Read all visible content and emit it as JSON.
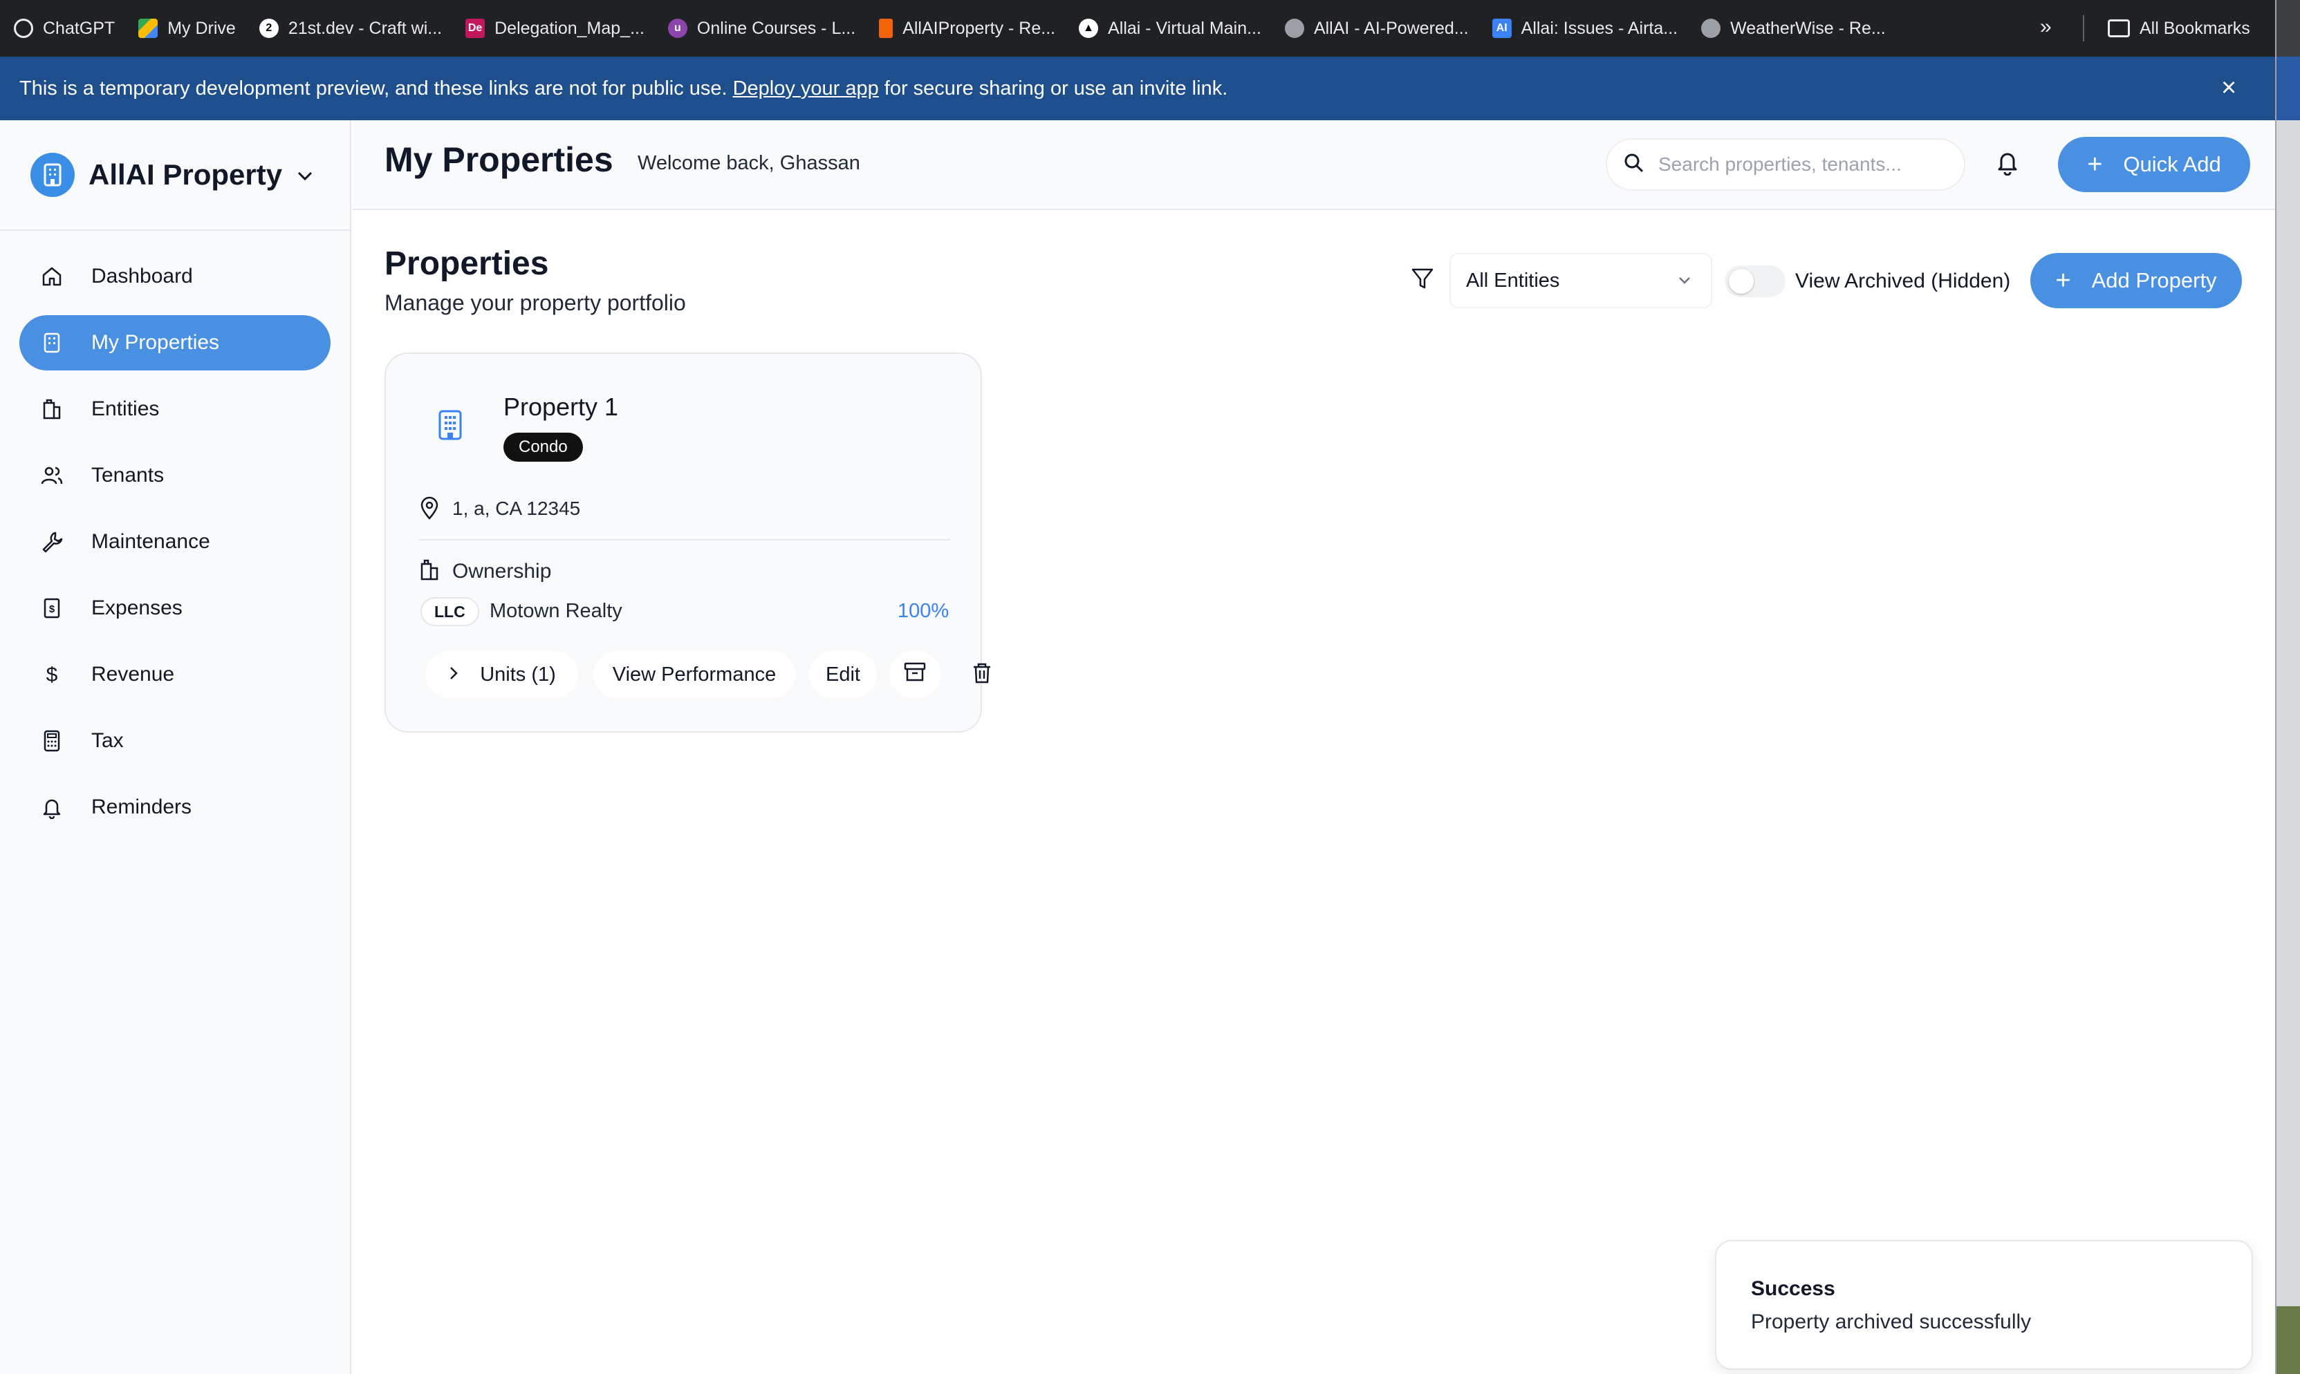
{
  "bookmarks": {
    "items": [
      {
        "label": "ChatGPT",
        "icon": "chatgpt-icon",
        "color": "#202124"
      },
      {
        "label": "My Drive",
        "icon": "google-drive-icon",
        "color": "#1a73e8"
      },
      {
        "label": "21st.dev - Craft wi...",
        "icon": "21st-icon",
        "color": "#000000"
      },
      {
        "label": "Delegation_Map_...",
        "icon": "de-icon",
        "color": "#c2185b"
      },
      {
        "label": "Online Courses - L...",
        "icon": "udemy-icon",
        "color": "#8e44ad"
      },
      {
        "label": "AllAIProperty - Re...",
        "icon": "replit-icon",
        "color": "#f26207"
      },
      {
        "label": "Allai - Virtual Main...",
        "icon": "triangle-icon",
        "color": "#000000"
      },
      {
        "label": "AllAI - AI-Powered...",
        "icon": "globe-icon",
        "color": "#5f6368"
      },
      {
        "label": "Allai: Issues - Airta...",
        "icon": "ai-icon",
        "color": "#3b82f6"
      },
      {
        "label": "WeatherWise - Re...",
        "icon": "globe-icon",
        "color": "#5f6368"
      }
    ],
    "more": "»",
    "all_label": "All Bookmarks"
  },
  "banner": {
    "text_before": "This is a temporary development preview, and these links are not for public use.",
    "link": "Deploy your app",
    "text_after": "for secure sharing or use an invite link.",
    "close": "×"
  },
  "sidebar": {
    "brand": "AllAI Property",
    "items": [
      {
        "label": "Dashboard",
        "icon": "home-icon",
        "active": false
      },
      {
        "label": "My Properties",
        "icon": "building-icon",
        "active": true
      },
      {
        "label": "Entities",
        "icon": "entities-icon",
        "active": false
      },
      {
        "label": "Tenants",
        "icon": "users-icon",
        "active": false
      },
      {
        "label": "Maintenance",
        "icon": "wrench-icon",
        "active": false
      },
      {
        "label": "Expenses",
        "icon": "receipt-icon",
        "active": false
      },
      {
        "label": "Revenue",
        "icon": "dollar-icon",
        "active": false
      },
      {
        "label": "Tax",
        "icon": "calculator-icon",
        "active": false
      },
      {
        "label": "Reminders",
        "icon": "bell-icon",
        "active": false
      }
    ]
  },
  "header": {
    "title": "My Properties",
    "welcome": "Welcome back, Ghassan",
    "search_placeholder": "Search properties, tenants...",
    "quick_add": "Quick Add"
  },
  "main": {
    "title": "Properties",
    "subtitle": "Manage your property portfolio",
    "entity_filter": "All Entities",
    "archived_toggle_label": "View Archived (Hidden)",
    "archived_toggle_on": false,
    "add_property": "Add Property"
  },
  "property": {
    "name": "Property 1",
    "type": "Condo",
    "address": "1, a, CA 12345",
    "ownership_label": "Ownership",
    "owner_type": "LLC",
    "owner_name": "Motown Realty",
    "owner_pct": "100%",
    "units_btn": "Units (1)",
    "performance_btn": "View Performance",
    "edit_btn": "Edit"
  },
  "toast": {
    "title": "Success",
    "message": "Property archived successfully"
  },
  "colors": {
    "accent": "#4a90e2",
    "banner": "#1e4e8c",
    "percent": "#3b82f6"
  }
}
